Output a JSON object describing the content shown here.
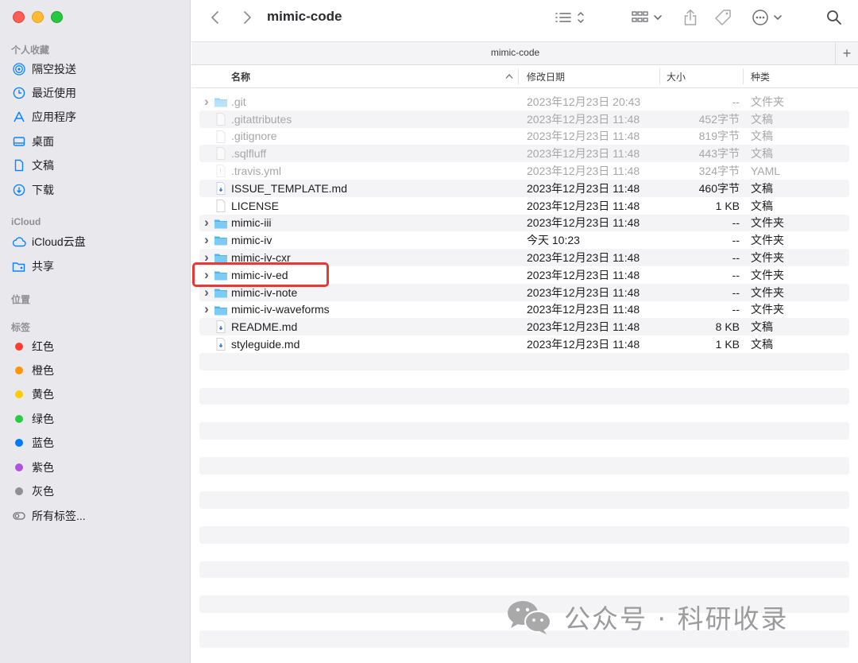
{
  "window": {
    "title": "mimic-code"
  },
  "tabbar": {
    "tab_label": "mimic-code",
    "add_label": "+"
  },
  "sidebar": {
    "favorites": {
      "header": "个人收藏",
      "items": [
        {
          "label": "隔空投送",
          "icon": "airdrop-icon"
        },
        {
          "label": "最近使用",
          "icon": "clock-icon"
        },
        {
          "label": "应用程序",
          "icon": "applications-icon"
        },
        {
          "label": "桌面",
          "icon": "desktop-icon"
        },
        {
          "label": "文稿",
          "icon": "document-icon"
        },
        {
          "label": "下载",
          "icon": "download-icon"
        }
      ]
    },
    "icloud": {
      "header": "iCloud",
      "items": [
        {
          "label": "iCloud云盘",
          "icon": "cloud-icon"
        },
        {
          "label": "共享",
          "icon": "shared-folder-icon"
        }
      ]
    },
    "locations": {
      "header": "位置"
    },
    "tags": {
      "header": "标签",
      "items": [
        {
          "label": "红色",
          "color": "#ff3b30"
        },
        {
          "label": "橙色",
          "color": "#ff9500"
        },
        {
          "label": "黄色",
          "color": "#ffcc00"
        },
        {
          "label": "绿色",
          "color": "#28cd41"
        },
        {
          "label": "蓝色",
          "color": "#007aff"
        },
        {
          "label": "紫色",
          "color": "#af52de"
        },
        {
          "label": "灰色",
          "color": "#8e8e93"
        },
        {
          "label": "所有标签...",
          "icon": "all-tags-icon"
        }
      ]
    }
  },
  "columns": {
    "name": "名称",
    "date": "修改日期",
    "size": "大小",
    "kind": "种类"
  },
  "files": [
    {
      "name": ".git",
      "date": "2023年12月23日 20:43",
      "size": "--",
      "kind": "文件夹",
      "type": "folder",
      "hidden": true
    },
    {
      "name": ".gitattributes",
      "date": "2023年12月23日 11:48",
      "size": "452字节",
      "kind": "文稿",
      "type": "file",
      "hidden": true
    },
    {
      "name": ".gitignore",
      "date": "2023年12月23日 11:48",
      "size": "819字节",
      "kind": "文稿",
      "type": "file",
      "hidden": true
    },
    {
      "name": ".sqlfluff",
      "date": "2023年12月23日 11:48",
      "size": "443字节",
      "kind": "文稿",
      "type": "file",
      "hidden": true
    },
    {
      "name": ".travis.yml",
      "date": "2023年12月23日 11:48",
      "size": "324字节",
      "kind": "YAML",
      "type": "yaml",
      "hidden": true
    },
    {
      "name": "ISSUE_TEMPLATE.md",
      "date": "2023年12月23日 11:48",
      "size": "460字节",
      "kind": "文稿",
      "type": "md",
      "hidden": false
    },
    {
      "name": "LICENSE",
      "date": "2023年12月23日 11:48",
      "size": "1 KB",
      "kind": "文稿",
      "type": "file",
      "hidden": false
    },
    {
      "name": "mimic-iii",
      "date": "2023年12月23日 11:48",
      "size": "--",
      "kind": "文件夹",
      "type": "folder",
      "hidden": false
    },
    {
      "name": "mimic-iv",
      "date": "今天 10:23",
      "size": "--",
      "kind": "文件夹",
      "type": "folder",
      "hidden": false
    },
    {
      "name": "mimic-iv-cxr",
      "date": "2023年12月23日 11:48",
      "size": "--",
      "kind": "文件夹",
      "type": "folder",
      "hidden": false
    },
    {
      "name": "mimic-iv-ed",
      "date": "2023年12月23日 11:48",
      "size": "--",
      "kind": "文件夹",
      "type": "folder",
      "hidden": false
    },
    {
      "name": "mimic-iv-note",
      "date": "2023年12月23日 11:48",
      "size": "--",
      "kind": "文件夹",
      "type": "folder",
      "hidden": false
    },
    {
      "name": "mimic-iv-waveforms",
      "date": "2023年12月23日 11:48",
      "size": "--",
      "kind": "文件夹",
      "type": "folder",
      "hidden": false
    },
    {
      "name": "README.md",
      "date": "2023年12月23日 11:48",
      "size": "8 KB",
      "kind": "文稿",
      "type": "md",
      "hidden": false
    },
    {
      "name": "styleguide.md",
      "date": "2023年12月23日 11:48",
      "size": "1 KB",
      "kind": "文稿",
      "type": "md",
      "hidden": false
    }
  ],
  "highlighted_file": "mimic-iv-ed",
  "watermark": {
    "text": "公众号 · 科研收录"
  }
}
